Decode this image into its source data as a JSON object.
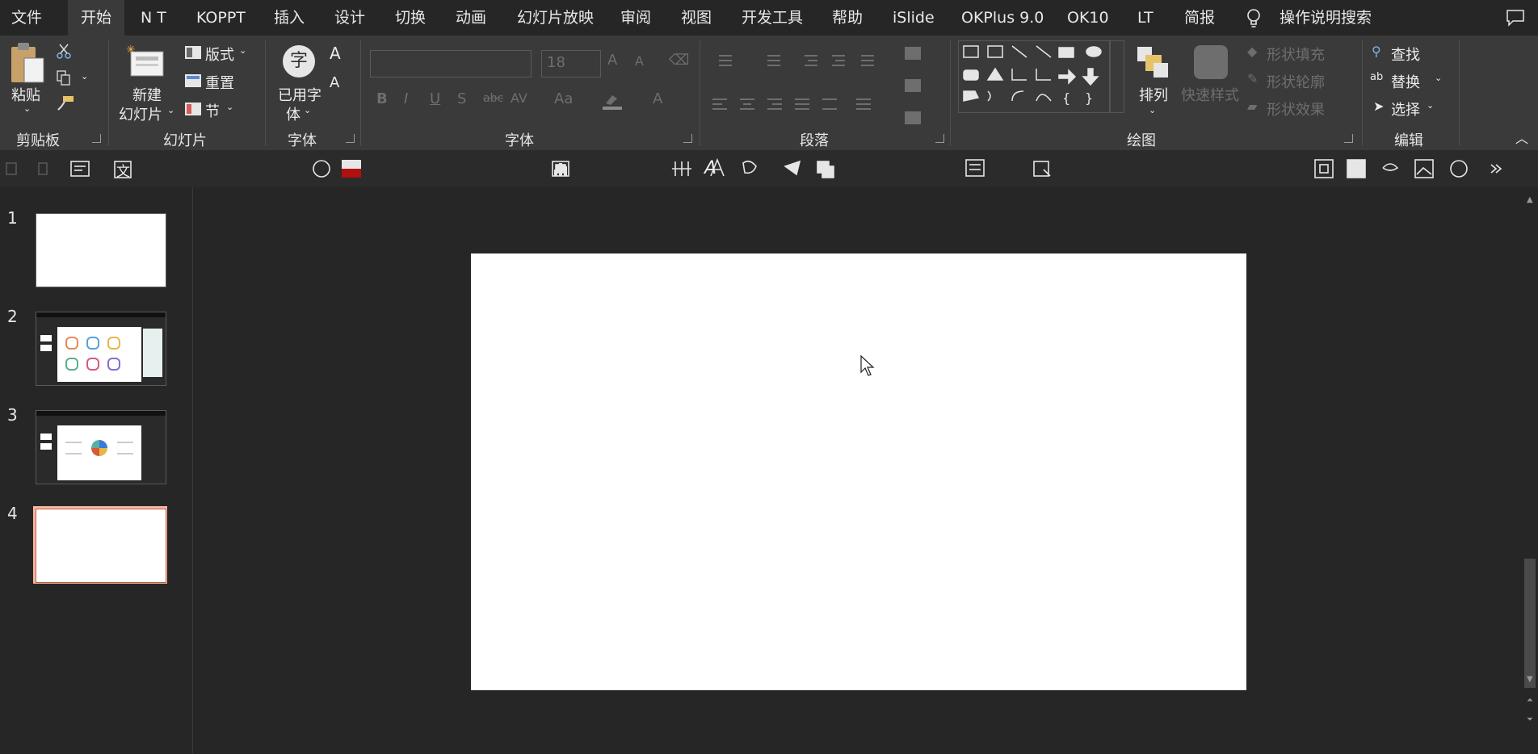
{
  "tabs": [
    {
      "label": "文件"
    },
    {
      "label": "开始"
    },
    {
      "label": "N T"
    },
    {
      "label": "KOPPT"
    },
    {
      "label": "插入"
    },
    {
      "label": "设计"
    },
    {
      "label": "切换"
    },
    {
      "label": "动画"
    },
    {
      "label": "幻灯片放映"
    },
    {
      "label": "审阅"
    },
    {
      "label": "视图"
    },
    {
      "label": "开发工具"
    },
    {
      "label": "帮助"
    },
    {
      "label": "iSlide"
    },
    {
      "label": "OKPlus 9.0"
    },
    {
      "label": "OK10"
    },
    {
      "label": "LT"
    },
    {
      "label": "简报"
    }
  ],
  "search": {
    "label": "操作说明搜索"
  },
  "ribbon": {
    "clipboard": {
      "paste": "粘贴",
      "group": "剪贴板"
    },
    "slides": {
      "new_slide_1": "新建",
      "new_slide_2": "幻灯片",
      "layout": "版式",
      "reset": "重置",
      "section": "节",
      "group": "幻灯片"
    },
    "used_fonts": {
      "glyph": "字",
      "label_1": "已用字",
      "label_2": "体",
      "group": "字体"
    },
    "font": {
      "size": "18",
      "group": "字体",
      "aa": "Aa"
    },
    "paragraph": {
      "group": "段落"
    },
    "drawing": {
      "arrange": "排列",
      "quick_styles": "快速样式",
      "fill": "形状填充",
      "outline": "形状轮廓",
      "effects": "形状效果",
      "group": "绘图"
    },
    "editing": {
      "find": "查找",
      "replace": "替换",
      "select": "选择",
      "group": "编辑"
    }
  },
  "qat": {
    "text_glyph": "文",
    "font_glyph": "A"
  },
  "thumbnails": [
    {
      "number": "1"
    },
    {
      "number": "2"
    },
    {
      "number": "3"
    },
    {
      "number": "4"
    }
  ],
  "selected_slide": "4",
  "colors": {
    "accent_selection": "#f4b8a4",
    "ribbon_bg": "#3a3a3a",
    "window_bg": "#262626"
  }
}
